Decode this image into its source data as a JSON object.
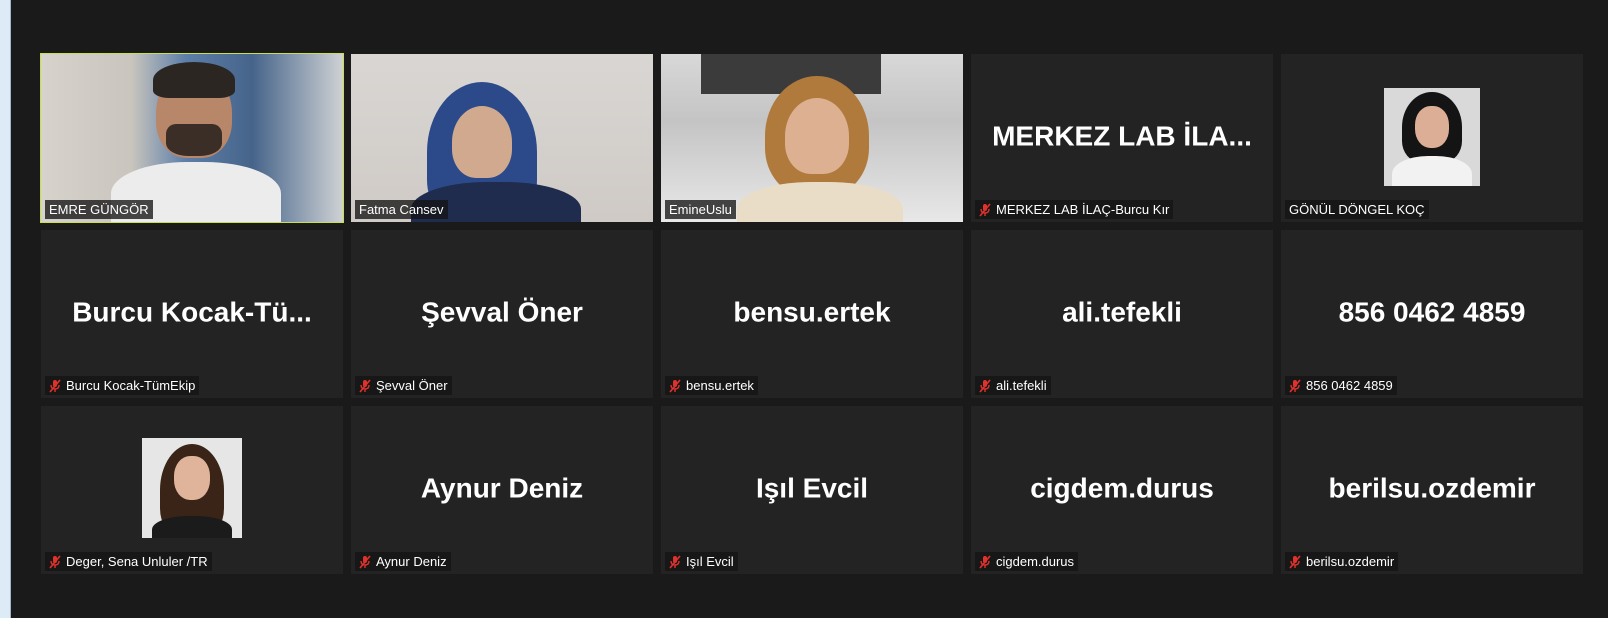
{
  "participants": [
    {
      "display": "",
      "label": "EMRE GÜNGÖR",
      "muted": false,
      "video": true
    },
    {
      "display": "",
      "label": "Fatma Cansev",
      "muted": false,
      "video": true
    },
    {
      "display": "",
      "label": "EmineUslu",
      "muted": false,
      "video": true
    },
    {
      "display": "MERKEZ LAB İLA...",
      "label": "MERKEZ LAB İLAÇ-Burcu Kır",
      "muted": true,
      "video": false
    },
    {
      "display": "",
      "label": "GÖNÜL DÖNGEL KOÇ",
      "muted": false,
      "video": false,
      "photo": true
    },
    {
      "display": "Burcu  Kocak-Tü...",
      "label": "Burcu Kocak-TümEkip",
      "muted": true,
      "video": false
    },
    {
      "display": "Şevval Öner",
      "label": "Şevval Öner",
      "muted": true,
      "video": false
    },
    {
      "display": "bensu.ertek",
      "label": "bensu.ertek",
      "muted": true,
      "video": false
    },
    {
      "display": "ali.tefekli",
      "label": "ali.tefekli",
      "muted": true,
      "video": false
    },
    {
      "display": "856 0462 4859",
      "label": "856 0462 4859",
      "muted": true,
      "video": false
    },
    {
      "display": "",
      "label": "Deger, Sena Unluler /TR",
      "muted": true,
      "video": false,
      "photo": true
    },
    {
      "display": "Aynur Deniz",
      "label": "Aynur Deniz",
      "muted": true,
      "video": false
    },
    {
      "display": "Işıl Evcil",
      "label": "Işıl Evcil",
      "muted": true,
      "video": false
    },
    {
      "display": "cigdem.durus",
      "label": "cigdem.durus",
      "muted": true,
      "video": false
    },
    {
      "display": "berilsu.ozdemir",
      "label": "berilsu.ozdemir",
      "muted": true,
      "video": false
    }
  ],
  "colors": {
    "active_speaker_border": "#c8e04b",
    "muted_icon": "#e0322b",
    "tile_background": "#232323",
    "window_background": "#1a1a1a"
  },
  "icons": {
    "muted": "muted-mic-icon"
  }
}
